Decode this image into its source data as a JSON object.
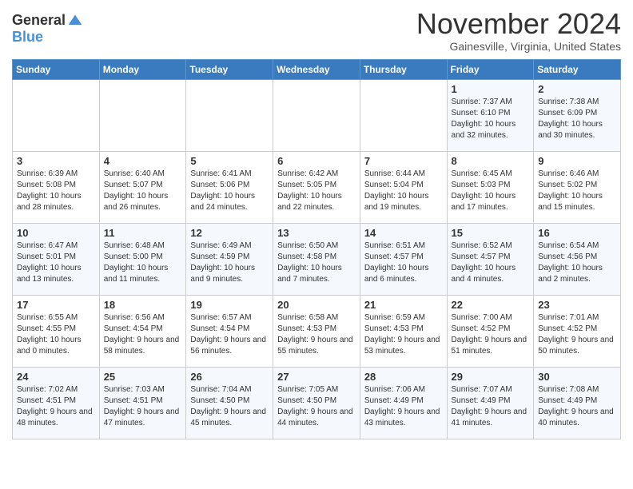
{
  "header": {
    "logo_general": "General",
    "logo_blue": "Blue",
    "month_title": "November 2024",
    "location": "Gainesville, Virginia, United States"
  },
  "days_of_week": [
    "Sunday",
    "Monday",
    "Tuesday",
    "Wednesday",
    "Thursday",
    "Friday",
    "Saturday"
  ],
  "weeks": [
    [
      {
        "day": "",
        "info": ""
      },
      {
        "day": "",
        "info": ""
      },
      {
        "day": "",
        "info": ""
      },
      {
        "day": "",
        "info": ""
      },
      {
        "day": "",
        "info": ""
      },
      {
        "day": "1",
        "info": "Sunrise: 7:37 AM\nSunset: 6:10 PM\nDaylight: 10 hours and 32 minutes."
      },
      {
        "day": "2",
        "info": "Sunrise: 7:38 AM\nSunset: 6:09 PM\nDaylight: 10 hours and 30 minutes."
      }
    ],
    [
      {
        "day": "3",
        "info": "Sunrise: 6:39 AM\nSunset: 5:08 PM\nDaylight: 10 hours and 28 minutes."
      },
      {
        "day": "4",
        "info": "Sunrise: 6:40 AM\nSunset: 5:07 PM\nDaylight: 10 hours and 26 minutes."
      },
      {
        "day": "5",
        "info": "Sunrise: 6:41 AM\nSunset: 5:06 PM\nDaylight: 10 hours and 24 minutes."
      },
      {
        "day": "6",
        "info": "Sunrise: 6:42 AM\nSunset: 5:05 PM\nDaylight: 10 hours and 22 minutes."
      },
      {
        "day": "7",
        "info": "Sunrise: 6:44 AM\nSunset: 5:04 PM\nDaylight: 10 hours and 19 minutes."
      },
      {
        "day": "8",
        "info": "Sunrise: 6:45 AM\nSunset: 5:03 PM\nDaylight: 10 hours and 17 minutes."
      },
      {
        "day": "9",
        "info": "Sunrise: 6:46 AM\nSunset: 5:02 PM\nDaylight: 10 hours and 15 minutes."
      }
    ],
    [
      {
        "day": "10",
        "info": "Sunrise: 6:47 AM\nSunset: 5:01 PM\nDaylight: 10 hours and 13 minutes."
      },
      {
        "day": "11",
        "info": "Sunrise: 6:48 AM\nSunset: 5:00 PM\nDaylight: 10 hours and 11 minutes."
      },
      {
        "day": "12",
        "info": "Sunrise: 6:49 AM\nSunset: 4:59 PM\nDaylight: 10 hours and 9 minutes."
      },
      {
        "day": "13",
        "info": "Sunrise: 6:50 AM\nSunset: 4:58 PM\nDaylight: 10 hours and 7 minutes."
      },
      {
        "day": "14",
        "info": "Sunrise: 6:51 AM\nSunset: 4:57 PM\nDaylight: 10 hours and 6 minutes."
      },
      {
        "day": "15",
        "info": "Sunrise: 6:52 AM\nSunset: 4:57 PM\nDaylight: 10 hours and 4 minutes."
      },
      {
        "day": "16",
        "info": "Sunrise: 6:54 AM\nSunset: 4:56 PM\nDaylight: 10 hours and 2 minutes."
      }
    ],
    [
      {
        "day": "17",
        "info": "Sunrise: 6:55 AM\nSunset: 4:55 PM\nDaylight: 10 hours and 0 minutes."
      },
      {
        "day": "18",
        "info": "Sunrise: 6:56 AM\nSunset: 4:54 PM\nDaylight: 9 hours and 58 minutes."
      },
      {
        "day": "19",
        "info": "Sunrise: 6:57 AM\nSunset: 4:54 PM\nDaylight: 9 hours and 56 minutes."
      },
      {
        "day": "20",
        "info": "Sunrise: 6:58 AM\nSunset: 4:53 PM\nDaylight: 9 hours and 55 minutes."
      },
      {
        "day": "21",
        "info": "Sunrise: 6:59 AM\nSunset: 4:53 PM\nDaylight: 9 hours and 53 minutes."
      },
      {
        "day": "22",
        "info": "Sunrise: 7:00 AM\nSunset: 4:52 PM\nDaylight: 9 hours and 51 minutes."
      },
      {
        "day": "23",
        "info": "Sunrise: 7:01 AM\nSunset: 4:52 PM\nDaylight: 9 hours and 50 minutes."
      }
    ],
    [
      {
        "day": "24",
        "info": "Sunrise: 7:02 AM\nSunset: 4:51 PM\nDaylight: 9 hours and 48 minutes."
      },
      {
        "day": "25",
        "info": "Sunrise: 7:03 AM\nSunset: 4:51 PM\nDaylight: 9 hours and 47 minutes."
      },
      {
        "day": "26",
        "info": "Sunrise: 7:04 AM\nSunset: 4:50 PM\nDaylight: 9 hours and 45 minutes."
      },
      {
        "day": "27",
        "info": "Sunrise: 7:05 AM\nSunset: 4:50 PM\nDaylight: 9 hours and 44 minutes."
      },
      {
        "day": "28",
        "info": "Sunrise: 7:06 AM\nSunset: 4:49 PM\nDaylight: 9 hours and 43 minutes."
      },
      {
        "day": "29",
        "info": "Sunrise: 7:07 AM\nSunset: 4:49 PM\nDaylight: 9 hours and 41 minutes."
      },
      {
        "day": "30",
        "info": "Sunrise: 7:08 AM\nSunset: 4:49 PM\nDaylight: 9 hours and 40 minutes."
      }
    ]
  ]
}
